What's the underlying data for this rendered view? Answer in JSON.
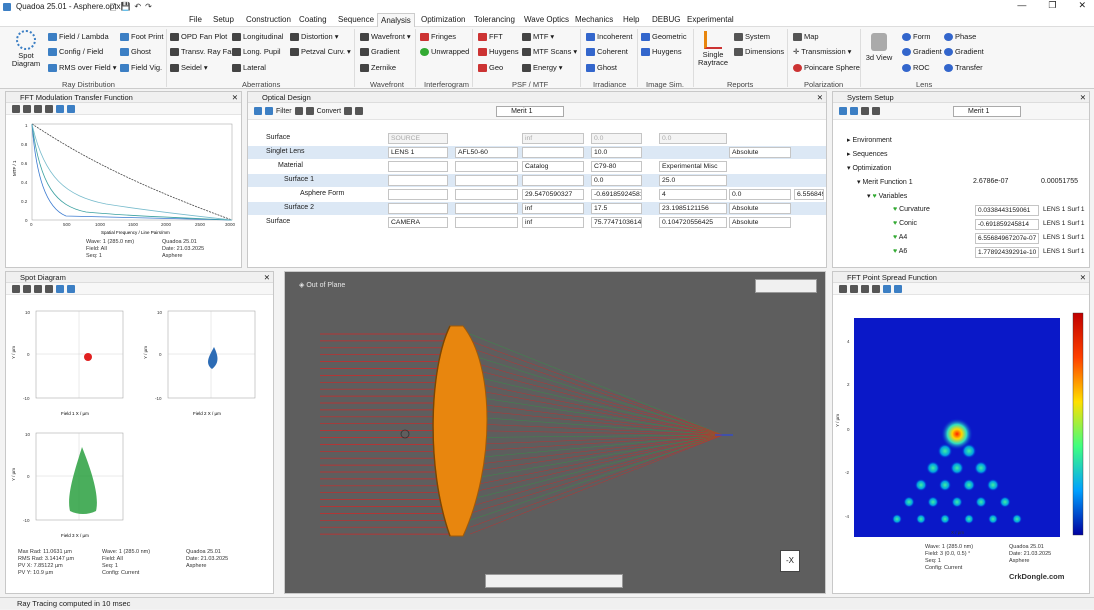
{
  "window": {
    "title": "Quadoa 25.01 - Asphere.optx"
  },
  "menu": [
    "File",
    "Setup",
    "Construction",
    "Coating",
    "Sequence",
    "Analysis",
    "Optimization",
    "Tolerancing",
    "Wave Optics",
    "Mechanics",
    "Help",
    "DEBUG",
    "Experimental"
  ],
  "ribbon": {
    "spot": "Spot Diagram",
    "field_lambda": "Field / Lambda",
    "config_field": "Config / Field",
    "rms_over_field": "RMS over Field",
    "opd_fan": "OPD Fan Plot",
    "transv_fan": "Transv. Ray Fan",
    "seidel": "Seidel",
    "foot_print": "Foot Print",
    "ghost": "Ghost",
    "field_vig": "Field Vig.",
    "longitudinal": "Longitudinal",
    "long_pupil": "Long. Pupil",
    "lateral": "Lateral",
    "distortion": "Distortion",
    "petzval": "Petzval Curv.",
    "wavefront": "Wavefront",
    "gradient": "Gradient",
    "zernike": "Zernike",
    "fringes": "Fringes",
    "unwrapped": "Unwrapped",
    "fft": "FFT",
    "huygens": "Huygens",
    "geo": "Geo",
    "mtf": "MTF",
    "mtf_scans": "MTF Scans",
    "energy": "Energy",
    "incoherent": "Incoherent",
    "coherent": "Coherent",
    "ghost2": "Ghost",
    "geometric": "Geometric",
    "huygens2": "Huygens",
    "single_raytrace": "Single Raytrace",
    "system": "System",
    "dimensions": "Dimensions",
    "map": "Map",
    "transmission": "Transmission",
    "poincare": "Poincare Sphere",
    "view3d": "3d View",
    "form": "Form",
    "gradient2": "Gradient",
    "roc": "ROC",
    "phase": "Phase",
    "gradient3": "Gradient",
    "transfer": "Transfer",
    "groups": [
      "Ray Distribution",
      "Aberrations",
      "Wavefront",
      "Interferogram",
      "PSF / MTF",
      "Irradiance",
      "Image Sim.",
      "Reports",
      "Polarization",
      "Lens"
    ]
  },
  "mtf": {
    "title": "FFT Modulation Transfer Function",
    "xlabel": "Spatial Frequency / Line Pairs/mm",
    "ylabel": "MTF / 1",
    "xticks": [
      "0",
      "500",
      "1000",
      "1500",
      "2000",
      "2500",
      "3000"
    ],
    "yticks": [
      "0",
      "0.2",
      "0.4",
      "0.6",
      "0.8",
      "1"
    ],
    "info1": "Wave: 1 (285.0 nm)",
    "info2": "Field: All",
    "info3": "Seq: 1",
    "info4": "Quadoa 25.01",
    "info5": "Date: 21.03.2025",
    "info6": "Asphere"
  },
  "design": {
    "title": "Optical Design",
    "filter": "Filter",
    "convert": "Convert",
    "merit": "Merit 1",
    "rows": [
      {
        "label": "Surface",
        "c1": "SOURCE",
        "c3": "inf",
        "c4": "0.0",
        "c5": "0.0"
      },
      {
        "label": "Singlet Lens",
        "c1": "LENS 1",
        "c2": "AFL50-60",
        "c3": "",
        "c4": "10.0",
        "c6": "Absolute"
      },
      {
        "label": "Material",
        "c1": "",
        "c2": "",
        "c3": "Catalog",
        "c4": "C79-80",
        "c5": "Experimental Misc"
      },
      {
        "label": "Surface 1",
        "c1": "",
        "c2": "",
        "c3": "",
        "c4": "0.0",
        "c5": "25.0"
      },
      {
        "label": "Asphere Form",
        "c1": "",
        "c2": "",
        "c3": "29.5470590327",
        "c4": "-0.691859245814",
        "c5": "4",
        "c6": "0.0",
        "c7": "6.556849"
      },
      {
        "label": "Surface 2",
        "c1": "",
        "c2": "",
        "c3": "inf",
        "c4": "17.5",
        "c5": "23.1985121156",
        "c6": "Absolute"
      },
      {
        "label": "Surface",
        "c1": "CAMERA",
        "c2": "",
        "c3": "inf",
        "c4": "75.7747103614",
        "c5": "0.104720556425",
        "c6": "Absolute"
      }
    ]
  },
  "system": {
    "title": "System Setup",
    "merit": "Merit 1",
    "environment": "Environment",
    "sequences": "Sequences",
    "optimization": "Optimization",
    "merit_fn": "Merit Function 1",
    "mf_val1": "2.6786e-07",
    "mf_val2": "0.00051755",
    "variables": "Variables",
    "vars": [
      {
        "name": "Curvature",
        "value": "0.0338443159061",
        "lens": "LENS 1 Surf 1"
      },
      {
        "name": "Conic",
        "value": "-0.691859245814",
        "lens": "LENS 1 Surf 1"
      },
      {
        "name": "A4",
        "value": "6.55684967207e-07",
        "lens": "LENS 1 Surf 1"
      },
      {
        "name": "A6",
        "value": "1.77892439291e-10",
        "lens": "LENS 1 Surf 1"
      }
    ]
  },
  "spot": {
    "title": "Spot Diagram",
    "field1": "Field 1 X / µm",
    "field2": "Field 2 X / µm",
    "field3": "Field 3 X / µm",
    "ylabel": "Y / µm",
    "ticks": [
      "10",
      "5",
      "0",
      "-5",
      "-10"
    ],
    "info": [
      "Max Rad: 11.0631 µm",
      "RMS Rad: 3.14147 µm",
      "PV X: 7.85122 µm",
      "PV Y: 10.9 µm"
    ],
    "info2": [
      "Wave: 1 (285.0 nm)",
      "Field: All",
      "Seq: 1",
      "Config: Current"
    ],
    "info3": [
      "Quadoa 25.01",
      "Date: 21.03.2025",
      "Asphere"
    ]
  },
  "view3d": {
    "label": "Out of Plane",
    "axis": "-X"
  },
  "psf": {
    "title": "FFT Point Spread Function",
    "xlabel": "X / µm",
    "ylabel": "Y / µm",
    "ticks": [
      "4",
      "2",
      "0",
      "-2",
      "-4"
    ],
    "cbar": [
      "1",
      "0.8",
      "0.6",
      "0.4",
      "0.2",
      "0"
    ],
    "info": [
      "Wave: 1 (285.0 nm)",
      "Field: 3 (0.0, 0.5) °",
      "Seq: 1",
      "Config: Current"
    ],
    "info2": [
      "Quadoa 25.01",
      "Date: 21.03.2025",
      "Asphere"
    ],
    "watermark": "CrkDongle.com"
  },
  "status": "Ray Tracing computed in 10 msec",
  "colors": {
    "accent": "#3c7fc4",
    "lens": "#e8860e",
    "ray_red": "#e02020",
    "ray_green": "#2aa040"
  }
}
